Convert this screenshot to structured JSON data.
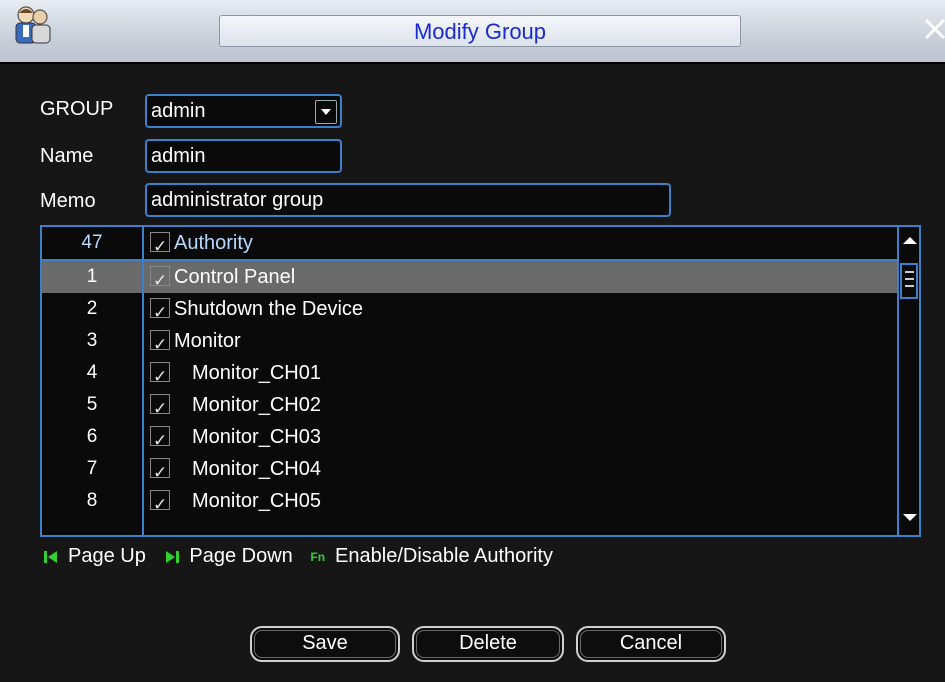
{
  "window": {
    "title": "Modify Group",
    "close_icon": "close-icon",
    "user_icon": "users-icon"
  },
  "form": {
    "group_label": "GROUP",
    "group_value": "admin",
    "name_label": "Name",
    "name_value": "admin",
    "memo_label": "Memo",
    "memo_value": "administrator group"
  },
  "table": {
    "header": {
      "count": "47",
      "label": "Authority",
      "checked": true
    },
    "rows": [
      {
        "num": "1",
        "label": "Control Panel",
        "checked": true,
        "selected": true
      },
      {
        "num": "2",
        "label": "Shutdown the Device",
        "checked": true
      },
      {
        "num": "3",
        "label": "Monitor",
        "checked": true
      },
      {
        "num": "4",
        "label": "Monitor_CH01",
        "checked": true
      },
      {
        "num": "5",
        "label": "Monitor_CH02",
        "checked": true
      },
      {
        "num": "6",
        "label": "Monitor_CH03",
        "checked": true
      },
      {
        "num": "7",
        "label": "Monitor_CH04",
        "checked": true
      },
      {
        "num": "8",
        "label": "Monitor_CH05",
        "checked": true
      }
    ]
  },
  "hints": {
    "page_up": "Page Up",
    "page_down": "Page Down",
    "fn_key": "Fn",
    "enable_disable": "Enable/Disable Authority"
  },
  "buttons": {
    "save": "Save",
    "delete": "Delete",
    "cancel": "Cancel"
  },
  "colors": {
    "accent_border": "#3d7fc8",
    "title_text": "#1a2bd0",
    "selected_row": "#6a6a6a",
    "hint_icon": "#2fd02f"
  }
}
